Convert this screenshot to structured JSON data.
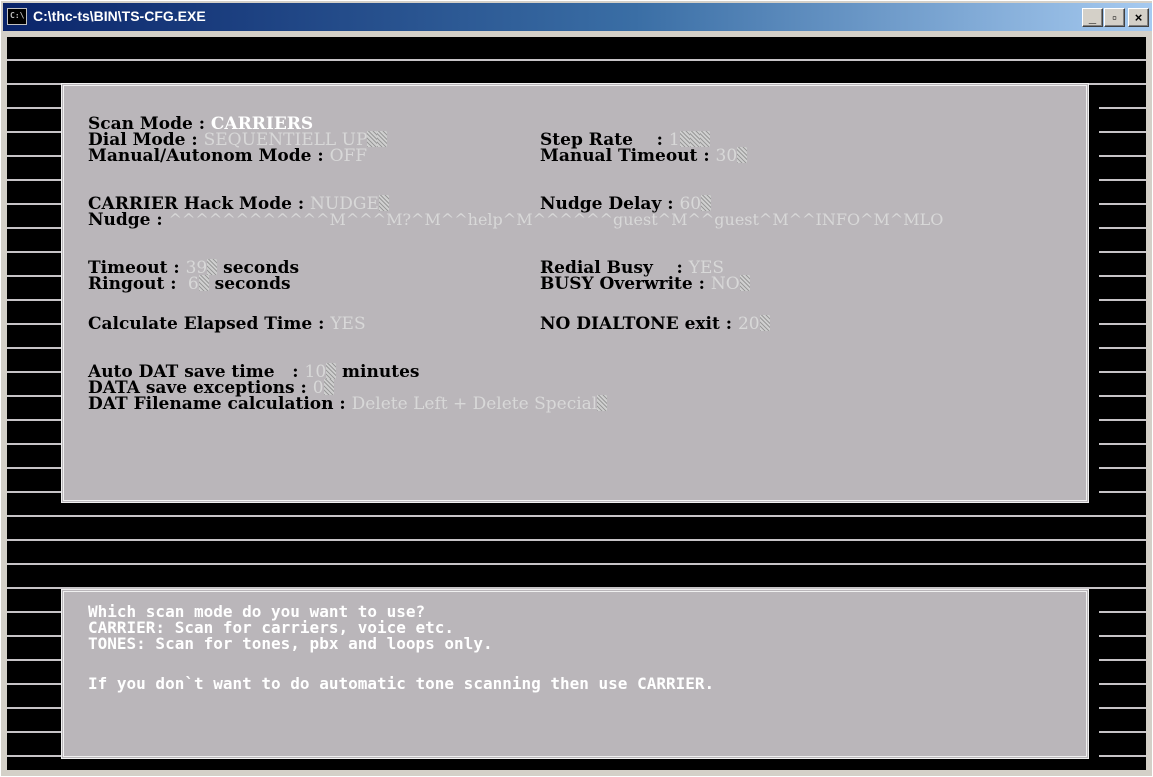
{
  "window": {
    "title": "C:\\thc-ts\\BIN\\TS-CFG.EXE",
    "icon_text": "C:\\",
    "buttons": {
      "minimize": "_",
      "maximize": "▫",
      "close": "×"
    }
  },
  "config": {
    "scan_mode": {
      "label": "Scan Mode : ",
      "value": "CARRIERS"
    },
    "dial_mode": {
      "label": "Dial Mode : ",
      "value": "SEQUENTIELL UP"
    },
    "step_rate": {
      "label": "Step Rate    : ",
      "value": "1"
    },
    "manual_mode": {
      "label": "Manual/Autonom Mode : ",
      "value": "OFF"
    },
    "manual_timeout": {
      "label": "Manual Timeout : ",
      "value": "30"
    },
    "hack_mode": {
      "label": "CARRIER Hack Mode : ",
      "value": "NUDGE"
    },
    "nudge_delay": {
      "label": "Nudge Delay : ",
      "value": "60"
    },
    "nudge": {
      "label": "Nudge : ",
      "value": "^^^^^^^^^^^^M^^^M?^M^^help^M^^^^^^guest^M^^guest^M^^INFO^M^MLO"
    },
    "timeout": {
      "label": "Timeout : ",
      "value": "39",
      "unit": " seconds"
    },
    "redial_busy": {
      "label": "Redial Busy    : ",
      "value": "YES"
    },
    "ringout": {
      "label": "Ringout : ",
      "value": " 6",
      "unit": " seconds"
    },
    "busy_overwrite": {
      "label": "BUSY Overwrite : ",
      "value": "NO"
    },
    "calc_elapsed": {
      "label": "Calculate Elapsed Time : ",
      "value": "YES"
    },
    "no_dialtone": {
      "label": "NO DIALTONE exit : ",
      "value": "20"
    },
    "auto_dat": {
      "label": "Auto DAT save time   : ",
      "value": "10",
      "unit": " minutes"
    },
    "data_exceptions": {
      "label": "DATA save exceptions : ",
      "value": "0"
    },
    "dat_filename": {
      "label": "DAT Filename calculation : ",
      "value": "Delete Left + Delete Special"
    }
  },
  "help": {
    "lines": [
      "Which scan mode do you want to use?",
      "CARRIER: Scan for carriers, voice etc.",
      "TONES: Scan for tones, pbx and loops only.",
      "If you don`t want to do automatic tone scanning then use CARRIER."
    ]
  },
  "colors": {
    "console_bg": "#000000",
    "panel_bg": "#bab6ba",
    "title_start": "#0a246a",
    "title_end": "#a6caf0"
  }
}
